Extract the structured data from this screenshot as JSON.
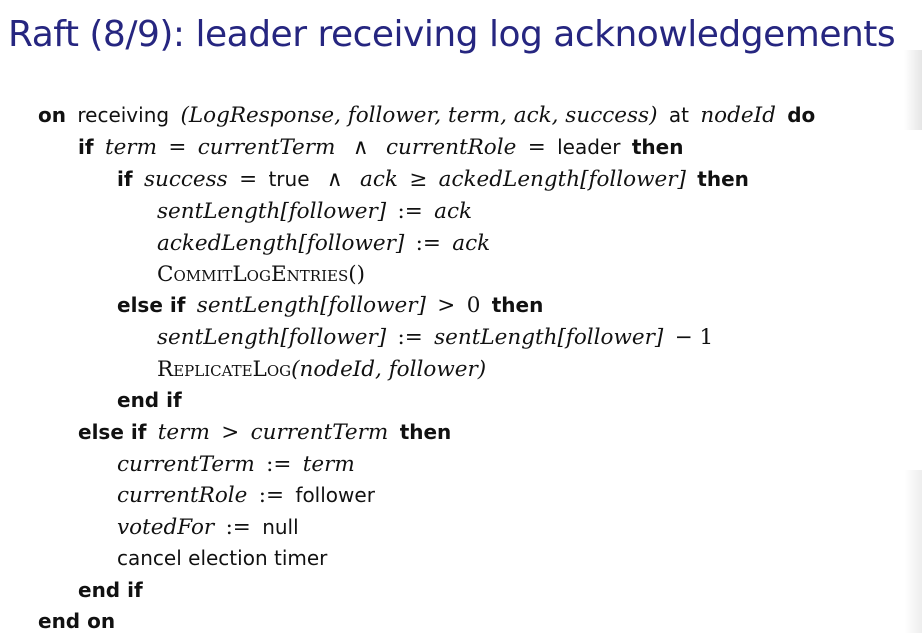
{
  "slide": {
    "title": "Raft (8/9): leader receiving log acknowledgements"
  },
  "algo": {
    "on": "on",
    "receiving": "receiving",
    "log_response_args": "(LogResponse, follower, term, ack, success)",
    "at": "at",
    "node_id": "nodeId",
    "do": "do",
    "if": "if",
    "term": "term",
    "eq": "=",
    "current_term": "currentTerm",
    "and": "∧",
    "current_role": "currentRole",
    "leader": "leader",
    "then": "then",
    "success": "success",
    "true": "true",
    "ack": "ack",
    "geq": "≥",
    "acked_length_follower": "ackedLength[follower]",
    "sent_length_follower": "sentLength[follower]",
    "assign": ":=",
    "commit_log_entries": "CommitLogEntries()",
    "else_if": "else if",
    "gt": ">",
    "zero": "0",
    "minus_one": "− 1",
    "replicate_log": "ReplicateLog",
    "replicate_args": "(nodeId, follower)",
    "end_if": "end if",
    "follower": "follower",
    "voted_for": "votedFor",
    "null": "null",
    "cancel_election_timer": "cancel election timer",
    "end_on": "end on"
  }
}
